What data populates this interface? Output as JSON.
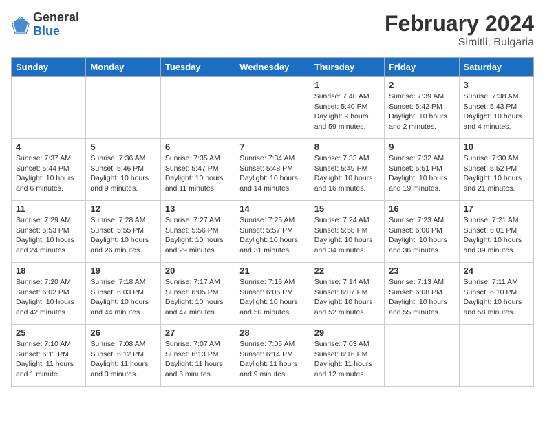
{
  "header": {
    "logo_general": "General",
    "logo_blue": "Blue",
    "title": "February 2024",
    "location": "Simitli, Bulgaria"
  },
  "days_of_week": [
    "Sunday",
    "Monday",
    "Tuesday",
    "Wednesday",
    "Thursday",
    "Friday",
    "Saturday"
  ],
  "weeks": [
    [
      {
        "day": "",
        "empty": true
      },
      {
        "day": "",
        "empty": true
      },
      {
        "day": "",
        "empty": true
      },
      {
        "day": "",
        "empty": true
      },
      {
        "day": "1",
        "sunrise": "Sunrise: 7:40 AM",
        "sunset": "Sunset: 5:40 PM",
        "daylight": "Daylight: 9 hours and 59 minutes."
      },
      {
        "day": "2",
        "sunrise": "Sunrise: 7:39 AM",
        "sunset": "Sunset: 5:42 PM",
        "daylight": "Daylight: 10 hours and 2 minutes."
      },
      {
        "day": "3",
        "sunrise": "Sunrise: 7:38 AM",
        "sunset": "Sunset: 5:43 PM",
        "daylight": "Daylight: 10 hours and 4 minutes."
      }
    ],
    [
      {
        "day": "4",
        "sunrise": "Sunrise: 7:37 AM",
        "sunset": "Sunset: 5:44 PM",
        "daylight": "Daylight: 10 hours and 6 minutes."
      },
      {
        "day": "5",
        "sunrise": "Sunrise: 7:36 AM",
        "sunset": "Sunset: 5:46 PM",
        "daylight": "Daylight: 10 hours and 9 minutes."
      },
      {
        "day": "6",
        "sunrise": "Sunrise: 7:35 AM",
        "sunset": "Sunset: 5:47 PM",
        "daylight": "Daylight: 10 hours and 11 minutes."
      },
      {
        "day": "7",
        "sunrise": "Sunrise: 7:34 AM",
        "sunset": "Sunset: 5:48 PM",
        "daylight": "Daylight: 10 hours and 14 minutes."
      },
      {
        "day": "8",
        "sunrise": "Sunrise: 7:33 AM",
        "sunset": "Sunset: 5:49 PM",
        "daylight": "Daylight: 10 hours and 16 minutes."
      },
      {
        "day": "9",
        "sunrise": "Sunrise: 7:32 AM",
        "sunset": "Sunset: 5:51 PM",
        "daylight": "Daylight: 10 hours and 19 minutes."
      },
      {
        "day": "10",
        "sunrise": "Sunrise: 7:30 AM",
        "sunset": "Sunset: 5:52 PM",
        "daylight": "Daylight: 10 hours and 21 minutes."
      }
    ],
    [
      {
        "day": "11",
        "sunrise": "Sunrise: 7:29 AM",
        "sunset": "Sunset: 5:53 PM",
        "daylight": "Daylight: 10 hours and 24 minutes."
      },
      {
        "day": "12",
        "sunrise": "Sunrise: 7:28 AM",
        "sunset": "Sunset: 5:55 PM",
        "daylight": "Daylight: 10 hours and 26 minutes."
      },
      {
        "day": "13",
        "sunrise": "Sunrise: 7:27 AM",
        "sunset": "Sunset: 5:56 PM",
        "daylight": "Daylight: 10 hours and 29 minutes."
      },
      {
        "day": "14",
        "sunrise": "Sunrise: 7:25 AM",
        "sunset": "Sunset: 5:57 PM",
        "daylight": "Daylight: 10 hours and 31 minutes."
      },
      {
        "day": "15",
        "sunrise": "Sunrise: 7:24 AM",
        "sunset": "Sunset: 5:58 PM",
        "daylight": "Daylight: 10 hours and 34 minutes."
      },
      {
        "day": "16",
        "sunrise": "Sunrise: 7:23 AM",
        "sunset": "Sunset: 6:00 PM",
        "daylight": "Daylight: 10 hours and 36 minutes."
      },
      {
        "day": "17",
        "sunrise": "Sunrise: 7:21 AM",
        "sunset": "Sunset: 6:01 PM",
        "daylight": "Daylight: 10 hours and 39 minutes."
      }
    ],
    [
      {
        "day": "18",
        "sunrise": "Sunrise: 7:20 AM",
        "sunset": "Sunset: 6:02 PM",
        "daylight": "Daylight: 10 hours and 42 minutes."
      },
      {
        "day": "19",
        "sunrise": "Sunrise: 7:18 AM",
        "sunset": "Sunset: 6:03 PM",
        "daylight": "Daylight: 10 hours and 44 minutes."
      },
      {
        "day": "20",
        "sunrise": "Sunrise: 7:17 AM",
        "sunset": "Sunset: 6:05 PM",
        "daylight": "Daylight: 10 hours and 47 minutes."
      },
      {
        "day": "21",
        "sunrise": "Sunrise: 7:16 AM",
        "sunset": "Sunset: 6:06 PM",
        "daylight": "Daylight: 10 hours and 50 minutes."
      },
      {
        "day": "22",
        "sunrise": "Sunrise: 7:14 AM",
        "sunset": "Sunset: 6:07 PM",
        "daylight": "Daylight: 10 hours and 52 minutes."
      },
      {
        "day": "23",
        "sunrise": "Sunrise: 7:13 AM",
        "sunset": "Sunset: 6:08 PM",
        "daylight": "Daylight: 10 hours and 55 minutes."
      },
      {
        "day": "24",
        "sunrise": "Sunrise: 7:11 AM",
        "sunset": "Sunset: 6:10 PM",
        "daylight": "Daylight: 10 hours and 58 minutes."
      }
    ],
    [
      {
        "day": "25",
        "sunrise": "Sunrise: 7:10 AM",
        "sunset": "Sunset: 6:11 PM",
        "daylight": "Daylight: 11 hours and 1 minute."
      },
      {
        "day": "26",
        "sunrise": "Sunrise: 7:08 AM",
        "sunset": "Sunset: 6:12 PM",
        "daylight": "Daylight: 11 hours and 3 minutes."
      },
      {
        "day": "27",
        "sunrise": "Sunrise: 7:07 AM",
        "sunset": "Sunset: 6:13 PM",
        "daylight": "Daylight: 11 hours and 6 minutes."
      },
      {
        "day": "28",
        "sunrise": "Sunrise: 7:05 AM",
        "sunset": "Sunset: 6:14 PM",
        "daylight": "Daylight: 11 hours and 9 minutes."
      },
      {
        "day": "29",
        "sunrise": "Sunrise: 7:03 AM",
        "sunset": "Sunset: 6:16 PM",
        "daylight": "Daylight: 11 hours and 12 minutes."
      },
      {
        "day": "",
        "empty": true
      },
      {
        "day": "",
        "empty": true
      }
    ]
  ]
}
